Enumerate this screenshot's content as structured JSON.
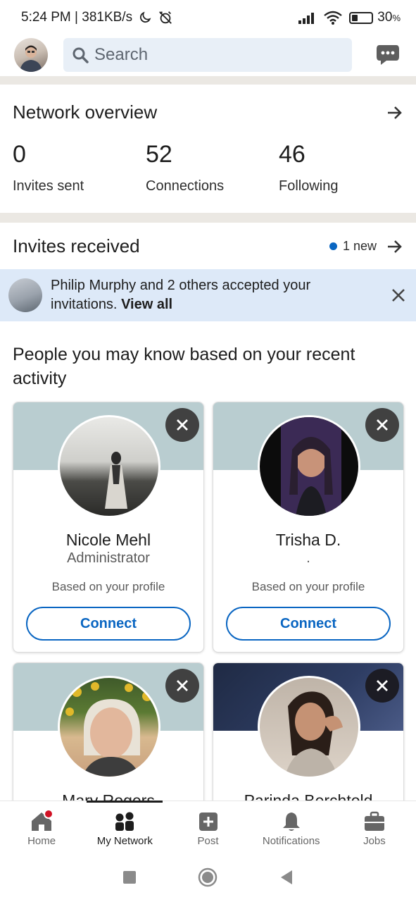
{
  "status_bar": {
    "time_speed": "5:24 PM | 381KB/s",
    "battery": "30",
    "battery_level": 0.3
  },
  "top_bar": {
    "search_placeholder": "Search",
    "icons": [
      "profile-avatar",
      "search-icon",
      "messaging-icon"
    ]
  },
  "network_overview": {
    "title": "Network overview",
    "stats": [
      {
        "value": "0",
        "label": "Invites sent"
      },
      {
        "value": "52",
        "label": "Connections"
      },
      {
        "value": "46",
        "label": "Following"
      }
    ]
  },
  "invites": {
    "title": "Invites received",
    "new_label": "1 new",
    "banner_text": "Philip Murphy and 2 others accepted your invitations.",
    "banner_link": "View all"
  },
  "pymk": {
    "heading": "People you may know based on your recent activity",
    "cards": [
      {
        "name": "Nicole Mehl",
        "headline": "Administrator",
        "reason": "Based on your profile",
        "action": "Connect"
      },
      {
        "name": "Trisha D.",
        "headline": ".",
        "reason": "Based on your profile",
        "action": "Connect"
      },
      {
        "name": "Mary Rogers",
        "headline": "",
        "reason": "",
        "action": ""
      },
      {
        "name": "Parinda Berchtold",
        "headline": "",
        "reason": "",
        "action": ""
      }
    ]
  },
  "bottom_nav": {
    "items": [
      {
        "label": "Home",
        "icon": "home-icon"
      },
      {
        "label": "My Network",
        "icon": "network-icon"
      },
      {
        "label": "Post",
        "icon": "post-icon"
      },
      {
        "label": "Notifications",
        "icon": "bell-icon"
      },
      {
        "label": "Jobs",
        "icon": "briefcase-icon"
      }
    ],
    "active_index": 1
  },
  "colors": {
    "accent": "#0a66c2",
    "card_banner": "#b9cdd0",
    "notification_dot": "#d11124",
    "invite_banner": "#dde9f8"
  }
}
